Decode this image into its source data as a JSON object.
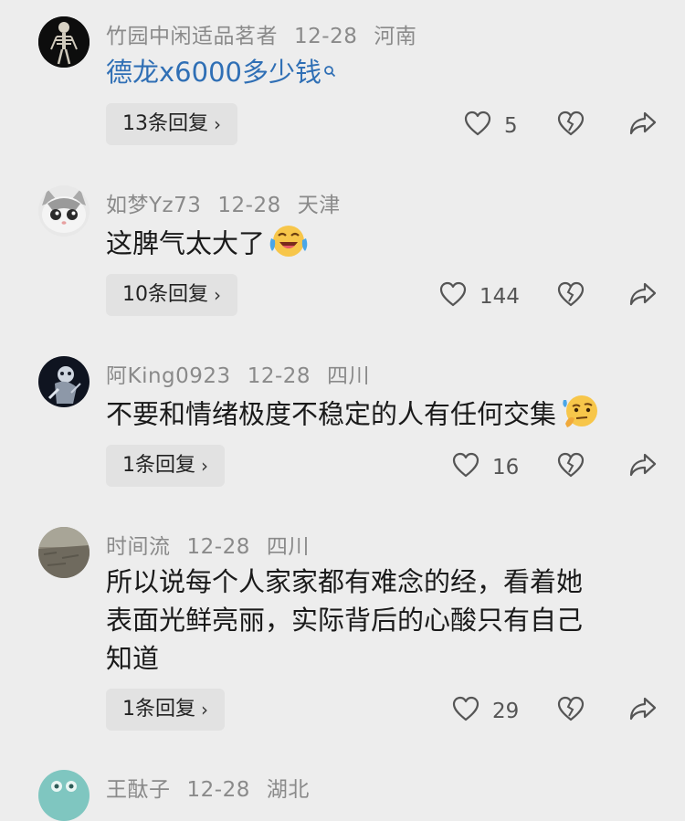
{
  "comments": [
    {
      "username": "竹园中闲适品茗者",
      "date": "12-28",
      "location": "河南",
      "text": "德龙x6000多少钱",
      "reply_label": "13条回复",
      "likes": "5"
    },
    {
      "username": "如梦Yz73",
      "date": "12-28",
      "location": "天津",
      "text": "这脾气太大了",
      "reply_label": "10条回复",
      "likes": "144"
    },
    {
      "username": "阿King0923",
      "date": "12-28",
      "location": "四川",
      "text": "不要和情绪极度不稳定的人有任何交集",
      "reply_label": "1条回复",
      "likes": "16"
    },
    {
      "username": "时间流",
      "date": "12-28",
      "location": "四川",
      "text_lines": [
        "所以说每个人家家都有难念的经，看着她",
        "表面光鲜亮丽，实际背后的心酸只有自己",
        "知道"
      ],
      "reply_label": "1条回复",
      "likes": "29"
    },
    {
      "username": "王酞子",
      "date": "12-28",
      "location": "湖北"
    }
  ],
  "icons": {
    "like": "heart-outline-icon",
    "dislike": "broken-heart-icon",
    "share": "share-arrow-icon",
    "search_hint": "search-icon"
  },
  "colors": {
    "link": "#2f6fb5",
    "meta": "#8a8a8a",
    "background": "#ededed"
  }
}
